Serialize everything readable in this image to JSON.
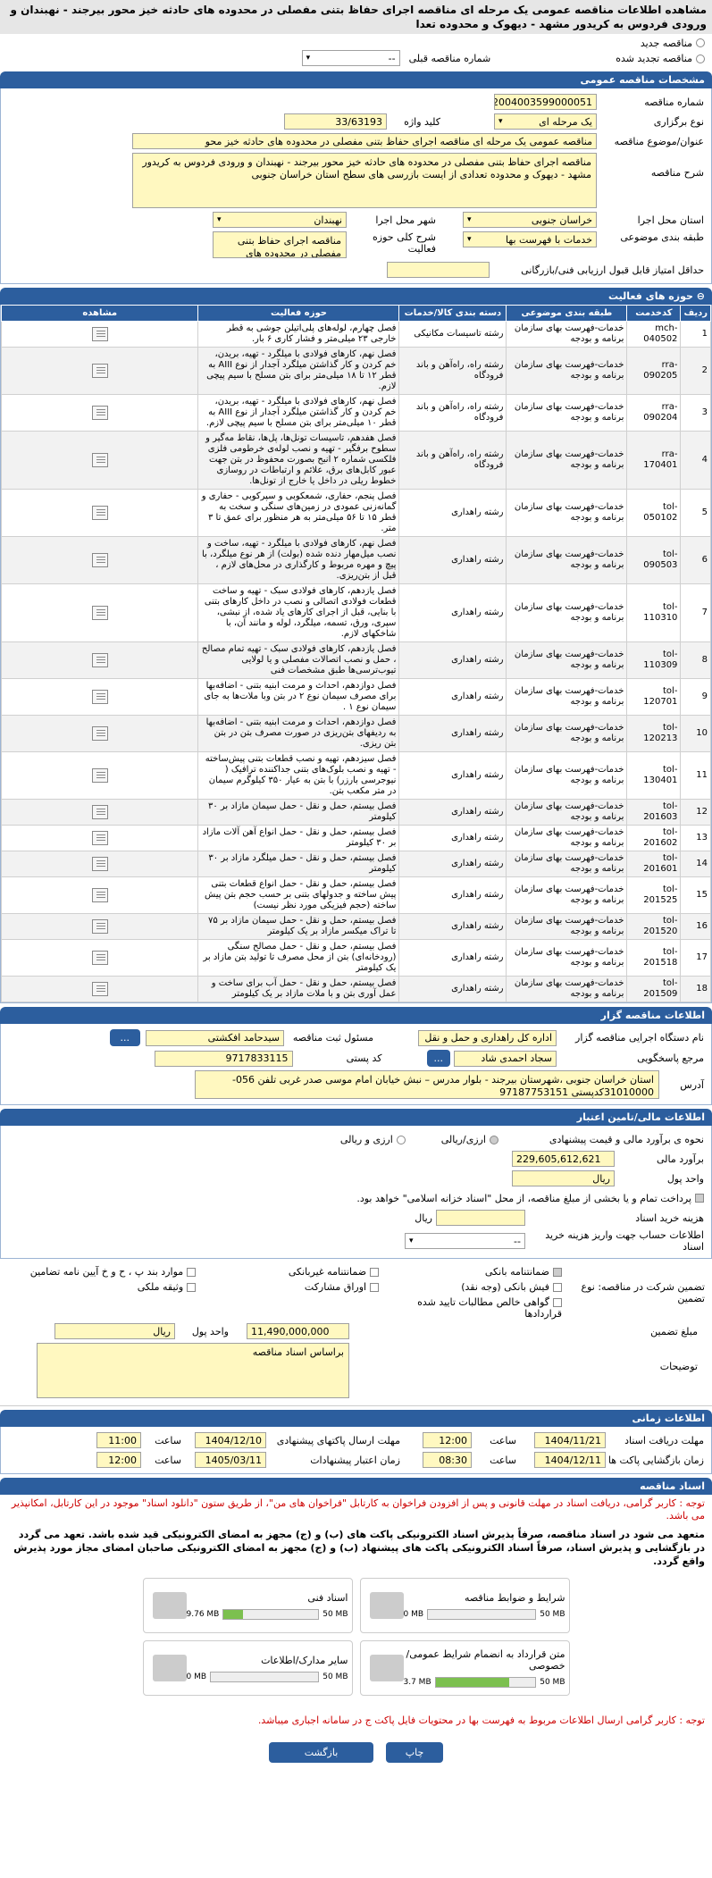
{
  "title": "مشاهده اطلاعات مناقصه عمومی یک مرحله ای مناقصه اجرای حفاظ بتنی مفصلی در محدوده های حادثه خیز محور بیرجند - نهبندان و ورودی فردوس به کریدور مشهد - دیهوک و محدوده تعدا",
  "tender_type": {
    "new": "مناقصه جدید",
    "renewed": "مناقصه تجدید شده",
    "prev_label": "شماره مناقصه قبلی",
    "prev_value": "--"
  },
  "general": {
    "header": "مشخصات مناقصه عمومی",
    "number_label": "شماره مناقصه",
    "number": "2004003599000051",
    "hold_label": "نوع برگزاری",
    "hold": "یک مرحله ای",
    "keyword_label": "کلید واژه",
    "keyword": "33/63193",
    "subject_label": "عنوان/موضوع مناقصه",
    "subject": "مناقصه عمومی یک مرحله ای مناقصه اجرای حفاظ بتنی مفصلی در محدوده های حادثه خیز محو",
    "desc_label": "شرح مناقصه",
    "desc": "مناقصه اجرای حفاظ بتنی مفصلی در محدوده های حادثه خیز محور بیرجند - نهبندان و ورودی فردوس به کریدور مشهد - دیهوک و محدوده تعدادی از ایست بازرسی های سطح استان خراسان جنوبی",
    "province_label": "استان محل اجرا",
    "province": "خراسان جنوبی",
    "city_label": "شهر محل اجرا",
    "city": "نهبندان",
    "class_label": "طبقه بندی موضوعی",
    "class": "خدمات با فهرست بها",
    "scope_label": "شرح کلی حوزه فعالیت",
    "scope": "مناقصه اجرای حفاظ بتنی مفصلی در محدوده های",
    "min_score_label": "حداقل امتیاز قابل قبول ارزیابی فنی/بازرگانی"
  },
  "activities": {
    "header": "حوزه های فعالیت",
    "cols": [
      "ردیف",
      "کدخدمت",
      "طبقه بندی موضوعی",
      "دسته بندی کالا/خدمات",
      "حوزه فعالیت",
      "مشاهده"
    ],
    "rows": [
      [
        "1",
        "mch-040502",
        "خدمات-فهرست بهای سازمان برنامه و بودجه",
        "رشته تاسیسات مکانیکی",
        "فصل چهارم، لوله‌های پلی‌اتیلن جوشی به قطر خارجی ۲۳ میلی‌متر و فشار کاری ۶ بار."
      ],
      [
        "2",
        "rra-090205",
        "خدمات-فهرست بهای سازمان برنامه و بودجه",
        "رشته راه، راه‌آهن و باند فرودگاه",
        "فصل نهم، کارهای فولادی با میلگرد - تهیه، بریدن، خم کردن و کار گذاشتن میلگرد آجدار از نوع AIII به قطر ۱۲ تا ۱۸ میلی‌متر برای بتن مسلح با سیم پیچی لازم."
      ],
      [
        "3",
        "rra-090204",
        "خدمات-فهرست بهای سازمان برنامه و بودجه",
        "رشته راه، راه‌آهن و باند فرودگاه",
        "فصل نهم، کارهای فولادی با میلگرد - تهیه، بریدن، خم کردن و کار گذاشتن میلگرد آجدار از نوع AIII به قطر ۱۰ میلی‌متر برای بتن مسلح با سیم پیچی لازم."
      ],
      [
        "4",
        "rra-170401",
        "خدمات-فهرست بهای سازمان برنامه و بودجه",
        "رشته راه، راه‌آهن و باند فرودگاه",
        "فصل هفدهم، تاسیسات تونل‌ها، پل‌ها، نقاط مه‌گیر و سطوح برفگیر - تهیه و نصب لوله‌ی خرطومی فلزی فلکسی شماره ۲ انبح بصورت محفوظ در بتن جهت عبور کابل‌های برق، علائم و ارتباطات در روسازی خطوط ریلی در داخل یا خارج از تونل‌ها."
      ],
      [
        "5",
        "tol-050102",
        "خدمات-فهرست بهای سازمان برنامه و بودجه",
        "رشته راهداری",
        "فصل پنجم، حفاری، شمعکوبی و سپرکوبی - حفاری و گمانه‌زنی عمودی در زمین‌های سنگی و سخت به قطر ۱۵ تا ۵۶ میلی‌متر به هر منظور برای عمق تا ۳ متر."
      ],
      [
        "6",
        "tol-090503",
        "خدمات-فهرست بهای سازمان برنامه و بودجه",
        "رشته راهداری",
        "فصل نهم، کارهای فولادی با میلگرد - تهیه، ساخت و نصب میل‌مهار دنده شده (بولت) از هر نوع میلگرد، با پیچ و مهره مربوط و کارگذاری در محل‌های لازم ، قبل از بتن‌ریزی."
      ],
      [
        "7",
        "tol-110310",
        "خدمات-فهرست بهای سازمان برنامه و بودجه",
        "رشته راهداری",
        "فصل یازدهم، کارهای فولادی سبک - تهیه و ساخت قطعات فولادی اتصالی و نصب در داخل کارهای بتنی با بنایی، قبل از اجرای کارهای یاد شده، از نبشی، سپری، ورق، تسمه، میلگرد، لوله و مانند آن، با شاخکهای لازم."
      ],
      [
        "8",
        "tol-110309",
        "خدمات-فهرست بهای سازمان برنامه و بودجه",
        "رشته راهداری",
        "فصل یازدهم، کارهای فولادی سبک - تهیه تمام مصالح ، حمل و نصب اتصالات مفصلی و یا لولایی تیوب‌ترسی‌ها طبق مشخصات فنی"
      ],
      [
        "9",
        "tol-120701",
        "خدمات-فهرست بهای سازمان برنامه و بودجه",
        "رشته راهداری",
        "فصل دوازدهم، احداث و مرمت ابنیه بتنی - اضافه‌بها برای مصرف سیمان نوع ۲ در بتن وبا ملات‌ها به جای سیمان نوع ۱ ."
      ],
      [
        "10",
        "tol-120213",
        "خدمات-فهرست بهای سازمان برنامه و بودجه",
        "رشته راهداری",
        "فصل دوازدهم، احداث و مرمت ابنیه بتنی - اضافه‌بها به ردیفهای بتن‌ریزی در صورت مصرف بتن در بتن بتن ریزی."
      ],
      [
        "11",
        "tol-130401",
        "خدمات-فهرست بهای سازمان برنامه و بودجه",
        "رشته راهداری",
        "فصل سیزدهم، تهیه و نصب قطعات بتنی پیش‌ساخته - تهیه و نصب بلوک‌های بتنی جداکننده ترافیک ( نیوجرسی بارزر) با بتن به عیار ۳۵۰ کیلوگرم سیمان در متر مکعب بتن."
      ],
      [
        "12",
        "tol-201603",
        "خدمات-فهرست بهای سازمان برنامه و بودجه",
        "رشته راهداری",
        "فصل بیستم، حمل و نقل - حمل سیمان مازاد بر ۳۰ کیلومتر"
      ],
      [
        "13",
        "tol-201602",
        "خدمات-فهرست بهای سازمان برنامه و بودجه",
        "رشته راهداری",
        "فصل بیستم، حمل و نقل - حمل انواع آهن آلات مازاد بر ۳۰ کیلومتر"
      ],
      [
        "14",
        "tol-201601",
        "خدمات-فهرست بهای سازمان برنامه و بودجه",
        "رشته راهداری",
        "فصل بیستم، حمل و نقل - حمل میلگرد مازاد بر ۳۰ کیلومتر"
      ],
      [
        "15",
        "tol-201525",
        "خدمات-فهرست بهای سازمان برنامه و بودجه",
        "رشته راهداری",
        "فصل بیستم، حمل و نقل - حمل انواع قطعات بتنی پیش ساخته و جدولهای بتنی بر حسب حجم بتن پیش ساخته (حجم فیزیکی مورد نظر نیست)"
      ],
      [
        "16",
        "tol-201520",
        "خدمات-فهرست بهای سازمان برنامه و بودجه",
        "رشته راهداری",
        "فصل بیستم، حمل و نقل - حمل سیمان مازاد بر ۷۵ تا تراک میکسر مازاد بر یک کیلومتر"
      ],
      [
        "17",
        "tol-201518",
        "خدمات-فهرست بهای سازمان برنامه و بودجه",
        "رشته راهداری",
        "فصل بیستم، حمل و نقل - حمل مصالح سنگی (رودخانه‌ای) بتن از محل مصرف تا تولید بتن مازاد بر یک کیلومتر"
      ],
      [
        "18",
        "tol-201509",
        "خدمات-فهرست بهای سازمان برنامه و بودجه",
        "رشته راهداری",
        "فصل بیستم، حمل و نقل - حمل آب برای ساخت و عمل آوری بتن و با ملات مازاد بر یک کیلومتر"
      ]
    ]
  },
  "org": {
    "header": "اطلاعات مناقصه گزار",
    "exec_label": "نام دستگاه اجرایی مناقصه گزار",
    "exec": "اداره کل راهداری و حمل و نقل",
    "resp_label": "مسئول ثبت مناقصه",
    "resp": "سیدحامد افکشتی",
    "ref_label": "مرجع پاسخگویی",
    "ref": "سجاد احمدی شاد",
    "postal_label": "کد پستی",
    "postal": "9717833115",
    "addr_label": "آدرس",
    "addr": "استان خراسان جنوبی ،شهرستان بیرجند - بلوار مدرس – نبش خیابان امام موسی صدر غربی تلفن 056-31010000کدپستی 97187753151",
    "btn": "..."
  },
  "finance": {
    "header": "اطلاعات مالی/تامین اعتبار",
    "est_type_label": "نحوه ی برآورد مالی و قیمت پیشنهادی",
    "est_opt1": "ارزی/ریالی",
    "est_opt2": "ارزی و ریالی",
    "est_label": "برآورد مالی",
    "est": "229,605,612,621",
    "unit_label": "واحد پول",
    "unit": "ریال",
    "treasury": "پرداخت تمام و یا بخشی از مبلغ مناقصه، از محل \"اسناد خزانه اسلامی\" خواهد بود.",
    "doc_cost_label": "هزینه خرید اسناد",
    "doc_cost_unit": "ریال",
    "acct_label": "اطلاعات حساب جهت واریز هزینه خرید اسناد",
    "acct": "--"
  },
  "guarantee": {
    "type_label": "تضمین شرکت در مناقصه: نوع تضمین",
    "opts": [
      "ضمانتنامه بانکی",
      "ضمانتنامه غیربانکی",
      "موارد بند پ ، ح و خ آیین نامه تضامین",
      "فیش بانکی (وجه نقد)",
      "اوراق مشارکت",
      "وثیقه ملکی",
      "گواهی خالص مطالبات تایید شده قراردادها"
    ],
    "amount_label": "مبلغ تضمین",
    "amount": "11,490,000,000",
    "unit_label": "واحد پول",
    "unit": "ریال",
    "desc_label": "توضیحات",
    "desc": "براساس اسناد مناقصه"
  },
  "dates": {
    "header": "اطلاعات زمانی",
    "pub_label": "مهلت دریافت اسناد",
    "pub_date": "1404/11/21",
    "pub_time": "12:00",
    "send_label": "مهلت ارسال پاکتهای پیشنهادی",
    "send_date": "1404/12/10",
    "send_time": "11:00",
    "open_label": "زمان بازگشایی پاکت ها",
    "open_date": "1404/12/11",
    "open_time": "08:30",
    "valid_label": "زمان اعتبار پیشنهادات",
    "valid_date": "1405/03/11",
    "valid_time": "12:00",
    "time_label": "ساعت"
  },
  "docs": {
    "header": "اسناد مناقصه",
    "notice1": "توجه : کاربر گرامی، دریافت اسناد در مهلت قانونی و پس از افزودن فراخوان به کارتابل \"فراخوان های من\"، از طریق ستون \"دانلود اسناد\" موجود در این کارتابل، امکانپذیر می باشد.",
    "notice2": "متعهد می شود در اسناد مناقصه، صرفاً پذیرش اسناد الکترونیکی پاکت های (ب) و (ج) مجهز به امضای الکترونیکی قید شده باشد. تعهد می گردد در بازگشایی و پذیرش اسناد، صرفاً اسناد الکترونیکی پاکت های پیشنهاد (ب) و (ج) مجهز به امضای الکترونیکی صاحبان امضای مجاز مورد پذیرش واقع گردد.",
    "files": [
      {
        "name": "شرایط و ضوابط مناقصه",
        "size": "0 MB",
        "max": "50 MB",
        "fill": 0
      },
      {
        "name": "اسناد فنی",
        "size": "9.76 MB",
        "max": "50 MB",
        "fill": 0.2
      },
      {
        "name": "متن قرارداد به انضمام شرایط عمومی/خصوصی",
        "size": "3.7 MB",
        "max": "50 MB",
        "fill": 0.74
      },
      {
        "name": "سایر مدارک/اطلاعات",
        "size": "0 MB",
        "max": "50 MB",
        "fill": 0
      }
    ],
    "notice3": "توجه : کاربر گرامی ارسال اطلاعات مربوط به فهرست بها در محتویات فایل پاکت ج در سامانه اجباری میباشد."
  },
  "footer": {
    "back": "بازگشت",
    "print": "چاپ"
  }
}
